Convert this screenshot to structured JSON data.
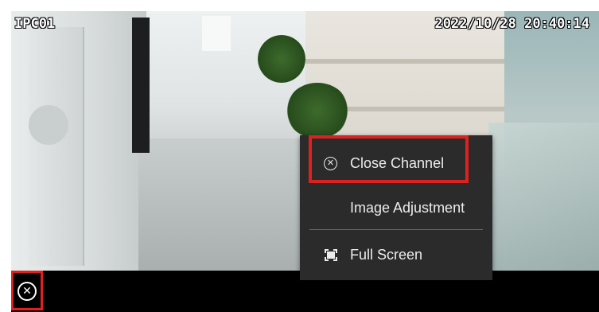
{
  "video": {
    "channel_name": "IPC01",
    "timestamp": "2022/10/28 20:40:14"
  },
  "toolbar": {
    "close_icon": "close-circle-icon"
  },
  "context_menu": {
    "items": [
      {
        "label": "Close Channel",
        "icon": "close-circle-icon"
      },
      {
        "label": "Image Adjustment",
        "icon": ""
      },
      {
        "label": "Full Screen",
        "icon": "fullscreen-icon"
      }
    ]
  },
  "highlight": {
    "color": "#e0201f"
  }
}
